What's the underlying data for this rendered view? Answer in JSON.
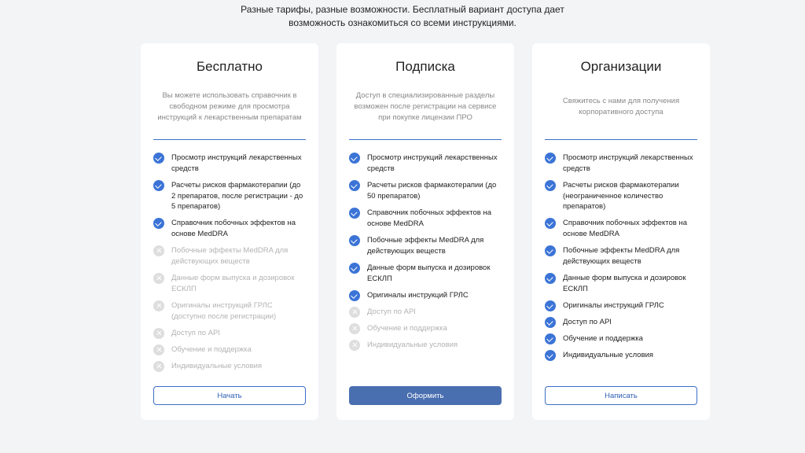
{
  "intro": {
    "line1": "Разные тарифы, разные возможности. Бесплатный вариант доступа дает",
    "line2": "возможность ознакомиться со всеми инструкциями."
  },
  "plans": [
    {
      "title": "Бесплатно",
      "description": "Вы можете использовать справочник в свободном режиме для просмотра инструкций к лекарственным препаратам",
      "button": "Начать",
      "features": [
        {
          "text": "Просмотр инструкций лекарственных средств",
          "available": true
        },
        {
          "text": "Расчеты рисков фармакотерапии (до 2 препаратов, после регистрации - до 5 препаратов)",
          "available": true
        },
        {
          "text": "Справочник побочных эффектов на основе MedDRA",
          "available": true
        },
        {
          "text": "Побочные эффекты MedDRA для действующих веществ",
          "available": false
        },
        {
          "text": "Данные форм выпуска и дозировок ЕСКЛП",
          "available": false
        },
        {
          "text": "Оригиналы инструкций ГРЛС (доступно после регистрации)",
          "available": false
        },
        {
          "text": "Доступ по API",
          "available": false
        },
        {
          "text": "Обучение и поддержка",
          "available": false
        },
        {
          "text": "Индивидуальные условия",
          "available": false
        }
      ]
    },
    {
      "title": "Подписка",
      "description": "Доступ в специализированные разделы возможен после регистрации на сервисе при покупке лицензии ПРО",
      "button": "Оформить",
      "features": [
        {
          "text": "Просмотр инструкций лекарственных средств",
          "available": true
        },
        {
          "text": "Расчеты рисков фармакотерапии (до 50 препаратов)",
          "available": true
        },
        {
          "text": "Справочник побочных эффектов на основе MedDRA",
          "available": true
        },
        {
          "text": "Побочные эффекты MedDRA для действующих веществ",
          "available": true
        },
        {
          "text": "Данные форм выпуска и дозировок ЕСКЛП",
          "available": true
        },
        {
          "text": "Оригиналы инструкций ГРЛС",
          "available": true
        },
        {
          "text": "Доступ по API",
          "available": false
        },
        {
          "text": "Обучение и поддержка",
          "available": false
        },
        {
          "text": "Индивидуальные условия",
          "available": false
        }
      ]
    },
    {
      "title": "Организации",
      "description": "Свяжитесь с нами для получения корпоративного доступа",
      "button": "Написать",
      "features": [
        {
          "text": "Просмотр инструкций лекарственных средств",
          "available": true
        },
        {
          "text": "Расчеты рисков фармакотерапии (неограниченное количество препаратов)",
          "available": true
        },
        {
          "text": "Справочник побочных эффектов на основе MedDRA",
          "available": true
        },
        {
          "text": "Побочные эффекты MedDRA для действующих веществ",
          "available": true
        },
        {
          "text": "Данные форм выпуска и дозировок ЕСКЛП",
          "available": true
        },
        {
          "text": "Оригиналы инструкций ГРЛС",
          "available": true
        },
        {
          "text": "Доступ по API",
          "available": true
        },
        {
          "text": "Обучение и поддержка",
          "available": true
        },
        {
          "text": "Индивидуальные условия",
          "available": true
        }
      ]
    }
  ],
  "colors": {
    "accent": "#3b74d6",
    "button_filled": "#4a6fb0",
    "background": "#f3f4f6",
    "disabled": "#dedede"
  },
  "icons": {
    "available": "check-circle-icon",
    "unavailable": "cross-circle-icon"
  }
}
